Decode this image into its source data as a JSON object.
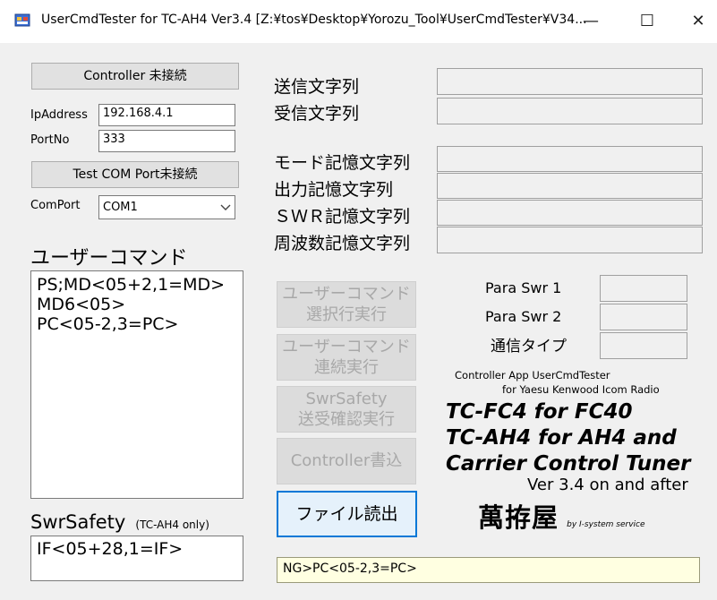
{
  "window": {
    "title": "UserCmdTester for TC-AH4 Ver3.4 [Z:¥tos¥Desktop¥Yorozu_Tool¥UserCmdTester¥V34...",
    "min_glyph": "—",
    "max_glyph": "☐",
    "close_glyph": "✕"
  },
  "left": {
    "controller_button": "Controller 未接続",
    "ip_label": "IpAddress",
    "ip_value": "192.168.4.1",
    "port_label": "PortNo",
    "port_value": "333",
    "testcom_button": "Test COM Port未接続",
    "comport_label": "ComPort",
    "comport_value": "COM1",
    "user_cmd_header": "ユーザーコマンド",
    "user_cmd_lines": [
      "PS;MD<05+2,1=MD>",
      "MD6<05>",
      "PC<05-2,3=PC>"
    ],
    "swrsafety_header": "SwrSafety",
    "swrsafety_note": "(TC-AH4 only)",
    "swrsafety_value": "IF<05+28,1=IF>"
  },
  "middle": {
    "send_label": "送信文字列",
    "recv_label": "受信文字列",
    "mode_label": "モード記憶文字列",
    "output_label": "出力記憶文字列",
    "swr_label": "ＳＷＲ記憶文字列",
    "freq_label": "周波数記憶文字列",
    "exec_selected_line1": "ユーザーコマンド",
    "exec_selected_line2": "選択行実行",
    "exec_cont_line1": "ユーザーコマンド",
    "exec_cont_line2": "連続実行",
    "swrsafety_btn_line1": "SwrSafety",
    "swrsafety_btn_line2": "送受確認実行",
    "controller_write": "Controller書込",
    "file_read": "ファイル読出"
  },
  "right": {
    "para_swr1_label": "Para Swr 1",
    "para_swr2_label": "Para Swr 2",
    "comm_type_label": "通信タイプ",
    "info_line1": "Controller App UserCmdTester",
    "info_line2": "for Yaesu Kenwood Icom Radio",
    "tc_line1": "TC-FC4 for FC40",
    "tc_line2": "TC-AH4 for AH4 and",
    "tc_line3": "Carrier Control Tuner",
    "ver_line": "Ver 3.4 on and after",
    "brand": "萬拵屋",
    "brand_sub": "by I-system service"
  },
  "status": {
    "text": "NG>PC<05-2,3=PC>"
  },
  "colors": {
    "status_bg": "#ffffe1",
    "file_button_border": "#0078d7",
    "disabled_text": "#a8a8a8"
  }
}
